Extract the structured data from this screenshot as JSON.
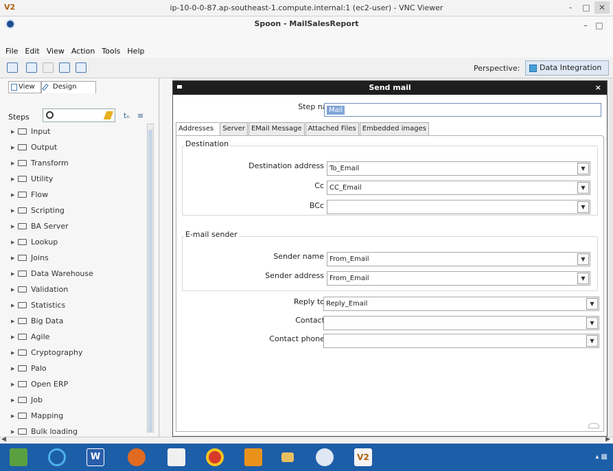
{
  "vnc": {
    "logo": "V2",
    "title": "ip-10-0-0-87.ap-southeast-1.compute.internal:1 (ec2-user) - VNC Viewer",
    "controls": [
      "-",
      "□",
      "✕"
    ]
  },
  "app": {
    "title": "Spoon - MailSalesReport",
    "window_controls": [
      "–",
      "□"
    ]
  },
  "menu": [
    "File",
    "Edit",
    "View",
    "Action",
    "Tools",
    "Help"
  ],
  "toolbar": {
    "perspective_label": "Perspective:",
    "perspective_value": "Data Integration"
  },
  "left_panel": {
    "tab_view": "View",
    "tab_design": "Design",
    "steps_label": "Steps",
    "search_value": "",
    "categories": [
      "Input",
      "Output",
      "Transform",
      "Utility",
      "Flow",
      "Scripting",
      "BA Server",
      "Lookup",
      "Joins",
      "Data Warehouse",
      "Validation",
      "Statistics",
      "Big Data",
      "Agile",
      "Cryptography",
      "Palo",
      "Open ERP",
      "Job",
      "Mapping",
      "Bulk loading"
    ]
  },
  "dialog": {
    "title": "Send mail",
    "close": "×",
    "step_name_label": "Step name",
    "step_name_value": "Mail",
    "tabs": [
      "Addresses",
      "Server",
      "EMail Message",
      "Attached Files",
      "Embedded images"
    ],
    "destination": {
      "title": "Destination",
      "dest_label": "Destination address",
      "dest_value": "To_Email",
      "cc_label": "Cc",
      "cc_value": "CC_Email",
      "bcc_label": "BCc",
      "bcc_value": ""
    },
    "sender": {
      "title": "E-mail sender",
      "name_label": "Sender name",
      "name_value": "From_Email",
      "address_label": "Sender address",
      "address_value": "From_Email"
    },
    "reply_to_label": "Reply to",
    "reply_to_value": "Reply_Email",
    "contact_label": "Contact",
    "contact_value": "",
    "contact_phone_label": "Contact phone",
    "contact_phone_value": ""
  },
  "taskbar": {
    "apps": [
      "explorer-app",
      "internet-explorer",
      "word",
      "firefox",
      "metro",
      "chrome",
      "outlook",
      "files",
      "kettle",
      "vnc"
    ],
    "vnc_label": "V2",
    "word_label": "W"
  }
}
